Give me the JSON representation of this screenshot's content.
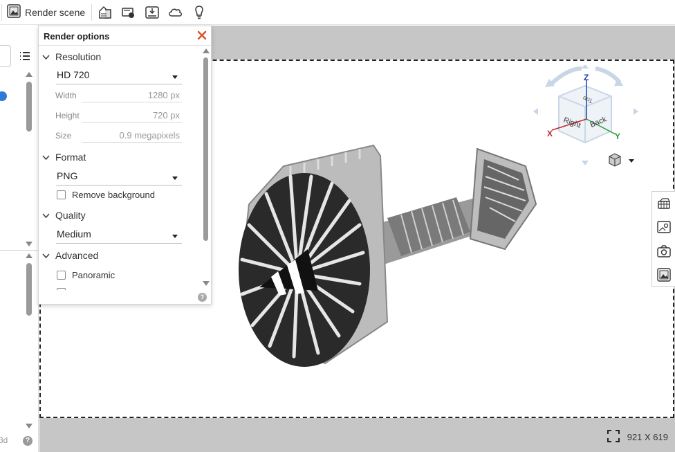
{
  "toolbar": {
    "render_scene_label": "Render scene",
    "icons": [
      "render-scene-icon",
      "appearances-icon",
      "lighting-icon",
      "import-environment-icon",
      "cloud-icon",
      "lightbulb-icon"
    ]
  },
  "render_options": {
    "title": "Render options",
    "resolution": {
      "heading": "Resolution",
      "preset": "HD 720",
      "width_label": "Width",
      "width_value": "1280 px",
      "height_label": "Height",
      "height_value": "720 px",
      "size_label": "Size",
      "size_value": "0.9 megapixels"
    },
    "format": {
      "heading": "Format",
      "value": "PNG",
      "remove_background_label": "Remove background",
      "remove_background_checked": false
    },
    "quality": {
      "heading": "Quality",
      "value": "Medium"
    },
    "advanced": {
      "heading": "Advanced",
      "panoramic_label": "Panoramic",
      "panoramic_checked": false
    },
    "help": "?"
  },
  "viewcube": {
    "axis_z": "Z",
    "axis_x": "X",
    "axis_y": "Y",
    "face_right": "Right",
    "face_back": "Back",
    "face_top": "Top"
  },
  "canvas": {
    "frame_size": "921 X 619"
  },
  "left_panel": {
    "cut_text": "3d",
    "help": "?"
  },
  "colors": {
    "close_x": "#d9532c",
    "canvas_bg": "#c6c6c6",
    "axis_x": "#c0262b",
    "axis_y": "#2e9a3a",
    "axis_z": "#1f3ea8"
  }
}
